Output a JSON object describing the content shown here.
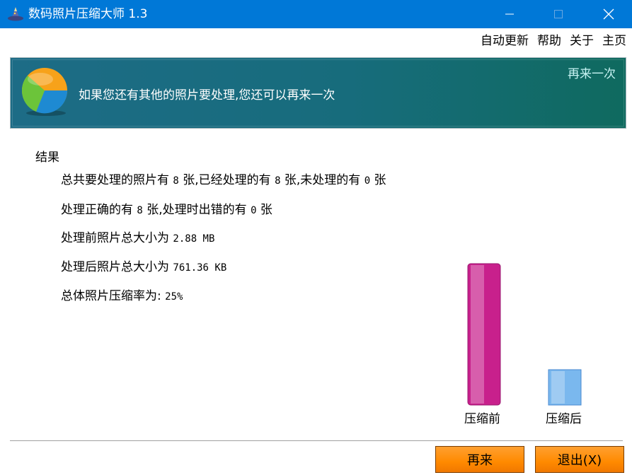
{
  "window": {
    "title": "数码照片压缩大师 1.3",
    "icons": {
      "app": "wizard-hat-icon",
      "minimize": "minimize-icon",
      "maximize": "maximize-icon",
      "close": "close-icon"
    }
  },
  "menu": {
    "auto_update": "自动更新",
    "help": "帮助",
    "about": "关于",
    "home": "主页"
  },
  "banner": {
    "message": "如果您还有其他的照片要处理,您还可以再来一次",
    "link": "再来一次",
    "logo_icon": "pie-chart-icon"
  },
  "results": {
    "heading": "结果",
    "line1": {
      "a": "总共要处理的照片有 ",
      "total": "8",
      "b": " 张,已经处理的有 ",
      "processed": "8",
      "c": " 张,未处理的有 ",
      "unprocessed": "0",
      "d": " 张"
    },
    "line2": {
      "a": "处理正确的有 ",
      "ok": "8",
      "b": " 张,处理时出错的有 ",
      "errors": "0",
      "c": " 张"
    },
    "line3": {
      "a": "处理前照片总大小为 ",
      "value": "2.88 MB"
    },
    "line4": {
      "a": "处理后照片总大小为 ",
      "value": "761.36 KB"
    },
    "line5": {
      "a": "总体照片压缩率为: ",
      "value": "25%"
    }
  },
  "chart_data": {
    "type": "bar",
    "categories": [
      "压缩前",
      "压缩后"
    ],
    "values": [
      100,
      25
    ],
    "colors": [
      "#c8208c",
      "#7ab8ee"
    ]
  },
  "buttons": {
    "again": "再来",
    "exit": "退出(X)"
  }
}
